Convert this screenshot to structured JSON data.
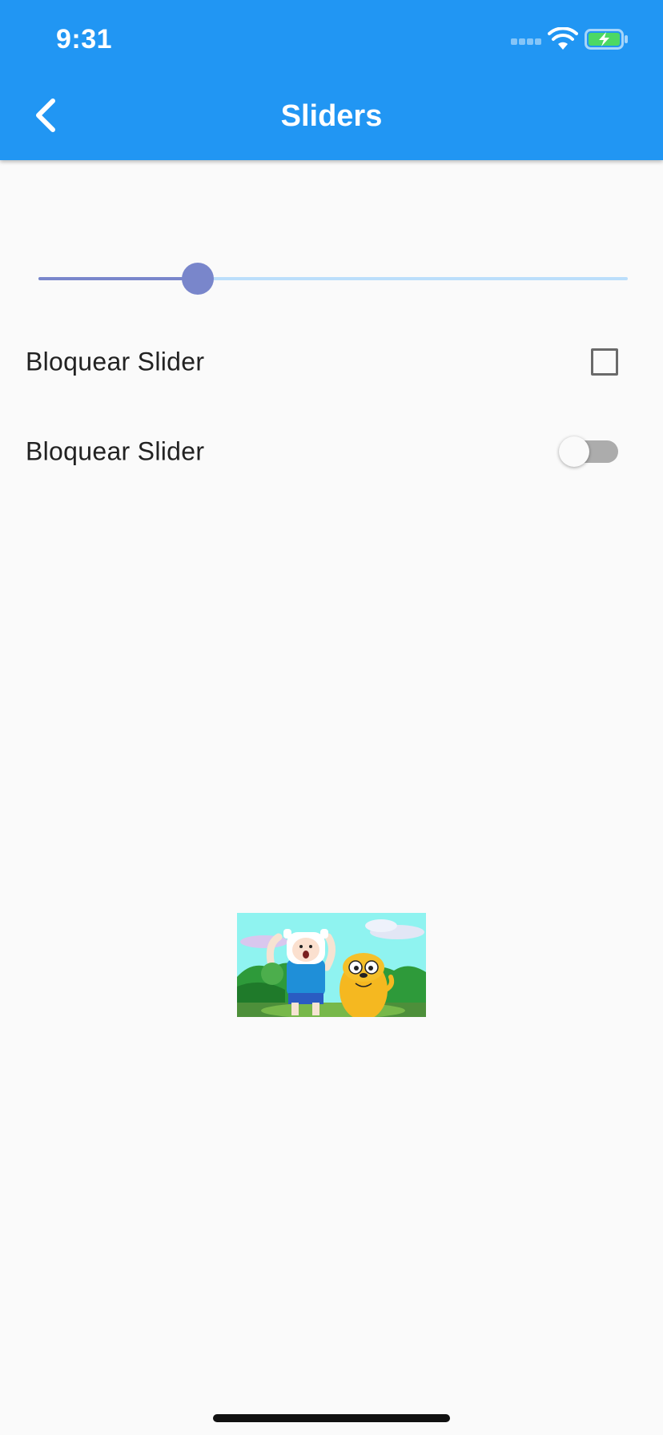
{
  "status_bar": {
    "time": "9:31",
    "icons": [
      "cellular-signal-icon",
      "wifi-icon",
      "battery-charging-icon"
    ]
  },
  "app_bar": {
    "title": "Sliders",
    "back_icon": "chevron-left-icon",
    "color": "#2196f3"
  },
  "slider": {
    "value_fraction": 0.27,
    "active_color": "#7986cb",
    "inactive_color": "#bbdefb"
  },
  "rows": [
    {
      "label": "Bloquear Slider",
      "control": "checkbox",
      "checked": false
    },
    {
      "label": "Bloquear Slider",
      "control": "switch",
      "on": false
    }
  ],
  "image": {
    "subject": "cartoon-characters-illustration"
  },
  "colors": {
    "background": "#fafafa",
    "text": "#222222"
  }
}
